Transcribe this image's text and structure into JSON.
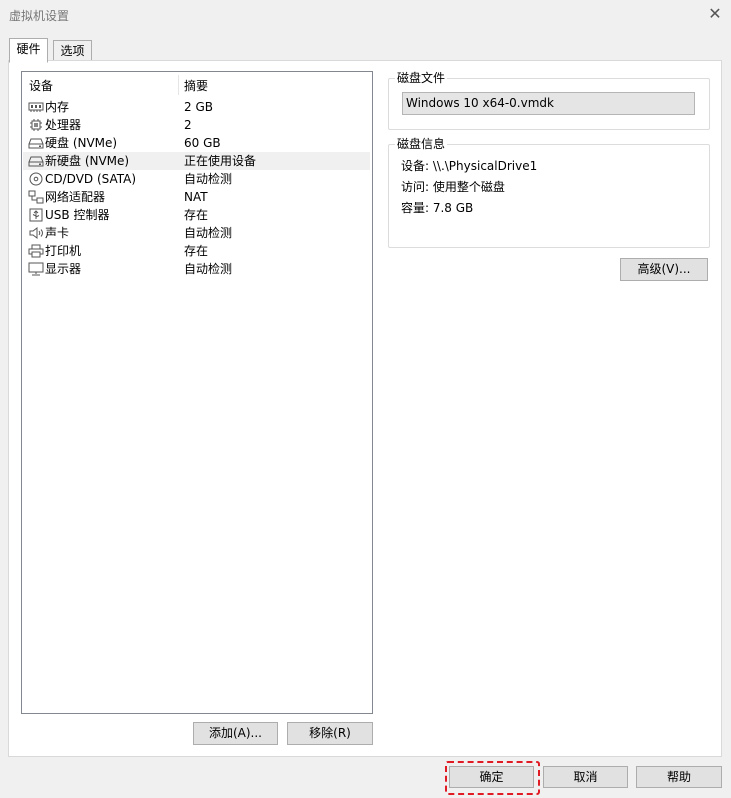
{
  "window": {
    "title": "虚拟机设置",
    "close_glyph": "✕"
  },
  "tabs": [
    {
      "label": "硬件",
      "active": true
    },
    {
      "label": "选项",
      "active": false
    }
  ],
  "device_list": {
    "columns": {
      "device": "设备",
      "summary": "摘要"
    },
    "rows": [
      {
        "icon": "memory-icon",
        "name": "内存",
        "summary": "2 GB",
        "selected": false
      },
      {
        "icon": "processor-icon",
        "name": "处理器",
        "summary": "2",
        "selected": false
      },
      {
        "icon": "hard-disk-icon",
        "name": "硬盘 (NVMe)",
        "summary": "60 GB",
        "selected": false
      },
      {
        "icon": "hard-disk-icon",
        "name": "新硬盘 (NVMe)",
        "summary": "正在使用设备",
        "selected": true
      },
      {
        "icon": "cd-dvd-icon",
        "name": "CD/DVD (SATA)",
        "summary": "自动检测",
        "selected": false
      },
      {
        "icon": "network-adapter-icon",
        "name": "网络适配器",
        "summary": "NAT",
        "selected": false
      },
      {
        "icon": "usb-controller-icon",
        "name": "USB 控制器",
        "summary": "存在",
        "selected": false
      },
      {
        "icon": "sound-card-icon",
        "name": "声卡",
        "summary": "自动检测",
        "selected": false
      },
      {
        "icon": "printer-icon",
        "name": "打印机",
        "summary": "存在",
        "selected": false
      },
      {
        "icon": "display-icon",
        "name": "显示器",
        "summary": "自动检测",
        "selected": false
      }
    ],
    "add_button": "添加(A)...",
    "remove_button": "移除(R)"
  },
  "disk_file": {
    "label": "磁盘文件",
    "value": "Windows 10 x64-0.vmdk"
  },
  "disk_info": {
    "label": "磁盘信息",
    "device": "设备:  \\\\.\\PhysicalDrive1",
    "access": "访问:  使用整个磁盘",
    "capacity": "容量: 7.8 GB"
  },
  "advanced_button": "高级(V)...",
  "footer": {
    "ok": "确定",
    "cancel": "取消",
    "help": "帮助"
  },
  "colors": {
    "focus_highlight": "#e01b24",
    "selected_row": "#f0f0f0"
  }
}
